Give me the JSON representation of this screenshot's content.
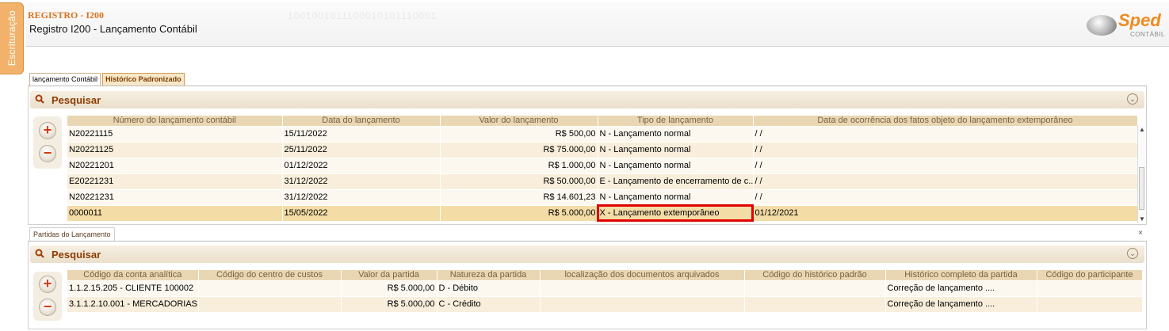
{
  "side_tab": {
    "label": "Escrituração"
  },
  "header": {
    "code": "REGISTRO - I200",
    "description": "Registro I200 - Lançamento Contábil",
    "logo_text": "Sped",
    "logo_sub": "CONTÁBIL"
  },
  "tabs": [
    {
      "label": "lançamento Contábil"
    },
    {
      "label": "Histórico Padronizado"
    }
  ],
  "search1": {
    "title": "Pesquisar",
    "add": "+",
    "remove": "−"
  },
  "table1": {
    "columns": [
      "Número do lançamento contábil",
      "Data do lançamento",
      "Valor do lançamento",
      "Tipo de lançamento",
      "Data de ocorrência dos fatos objeto do lançamento extemporâneo"
    ],
    "rows": [
      {
        "num": "N20221115",
        "date": "15/11/2022",
        "value": "R$ 500,00",
        "type": "N - Lançamento normal",
        "occ": " / /"
      },
      {
        "num": "N20221125",
        "date": "25/11/2022",
        "value": "R$ 75.000,00",
        "type": "N - Lançamento normal",
        "occ": " / /"
      },
      {
        "num": "N20221201",
        "date": "01/12/2022",
        "value": "R$ 1.000,00",
        "type": "N - Lançamento normal",
        "occ": " / /"
      },
      {
        "num": "E20221231",
        "date": "31/12/2022",
        "value": "R$ 50.000,00",
        "type": "E - Lançamento de encerramento de c...",
        "occ": " / /"
      },
      {
        "num": "N20221231",
        "date": "31/12/2022",
        "value": "R$ 14.601,23",
        "type": "N - Lançamento normal",
        "occ": " / /"
      },
      {
        "num": "0000011",
        "date": "15/05/2022",
        "value": "R$ 5.000,00",
        "type": "X - Lançamento extemporâneo",
        "occ": "01/12/2021"
      }
    ]
  },
  "subtab": {
    "label": "Partidas do Lançamento",
    "close": "×"
  },
  "search2": {
    "title": "Pesquisar",
    "add": "+",
    "remove": "−"
  },
  "table2": {
    "columns": [
      "Código da conta analítica",
      "Código do centro de custos",
      "Valor da partida",
      "Natureza da partida",
      "localização dos documentos arquivados",
      "Código do histórico padrão",
      "Histórico completo da partida",
      "Código do participante"
    ],
    "rows": [
      {
        "conta": "1.1.2.15.205 - CLIENTE 100002",
        "centro": "",
        "valor": "R$ 5.000,00",
        "nat": "D - Débito",
        "loc": "",
        "hist_cod": "",
        "hist": "Correção de lançamento ....",
        "part": ""
      },
      {
        "conta": "3.1.1.2.10.001 - MERCADORIAS ...",
        "centro": "",
        "valor": "R$ 5.000,00",
        "nat": "C - Crédito",
        "loc": "",
        "hist_cod": "",
        "hist": "Correção de lançamento ....",
        "part": ""
      }
    ]
  },
  "colors": {
    "accent": "#d9731e",
    "header_bg": "#e9d6b2",
    "highlight": "#e00000"
  }
}
